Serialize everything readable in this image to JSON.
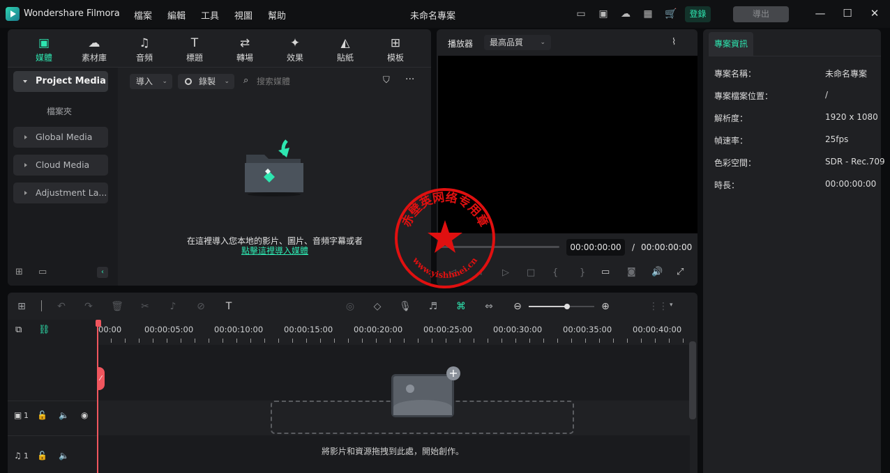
{
  "app": {
    "name": "Wondershare Filmora",
    "doc_title": "未命名專案",
    "login": "登錄",
    "export": "導出"
  },
  "menu": [
    "檔案",
    "編輯",
    "工具",
    "視圖",
    "幫助"
  ],
  "toolbar_tabs": [
    {
      "label": "媒體",
      "icon": "media-icon"
    },
    {
      "label": "素材庫",
      "icon": "stock-icon"
    },
    {
      "label": "音頻",
      "icon": "audio-icon"
    },
    {
      "label": "標題",
      "icon": "title-icon"
    },
    {
      "label": "轉場",
      "icon": "transition-icon"
    },
    {
      "label": "效果",
      "icon": "effects-icon"
    },
    {
      "label": "貼紙",
      "icon": "sticker-icon"
    },
    {
      "label": "模板",
      "icon": "template-icon"
    }
  ],
  "sidebar": {
    "project_media": "Project Media",
    "folder": "檔案夾",
    "items": [
      "Global Media",
      "Cloud Media",
      "Adjustment La..."
    ]
  },
  "media_bar": {
    "import": "導入",
    "record": "錄製",
    "search_placeholder": "搜索媒體"
  },
  "media_empty": {
    "hint": "在這裡導入您本地的影片、圖片、音頻字幕或者",
    "link": "點擊這裡導入媒體"
  },
  "player": {
    "label": "播放器",
    "quality": "最高品質",
    "current": "00:00:00:00",
    "sep": "/",
    "total": "00:00:00:00"
  },
  "project_info": {
    "tab": "專案資訊",
    "rows": [
      {
        "key": "專案名稱：",
        "value": "未命名專案"
      },
      {
        "key": "專案檔案位置：",
        "value": "/"
      },
      {
        "key": "解析度：",
        "value": "1920 x 1080"
      },
      {
        "key": "幀速率：",
        "value": "25fps"
      },
      {
        "key": "色彩空間：",
        "value": "SDR - Rec.709"
      },
      {
        "key": "時長：",
        "value": "00:00:00:00"
      }
    ]
  },
  "timeline": {
    "ruler": [
      "00:00",
      "00:00:05:00",
      "00:00:10:00",
      "00:00:15:00",
      "00:00:20:00",
      "00:00:25:00",
      "00:00:30:00",
      "00:00:35:00",
      "00:00:40:00"
    ],
    "video_track": "1",
    "audio_track": "1",
    "drop_hint": "將影片和資源拖拽到此處，開始創作。"
  },
  "watermark": {
    "text_top": "赤壁英网络专用章",
    "text_bottom": "www.yishimei.cn"
  },
  "colors": {
    "accent": "#2ee6b0",
    "playhead": "#f0565e",
    "stamp": "#e01010"
  }
}
